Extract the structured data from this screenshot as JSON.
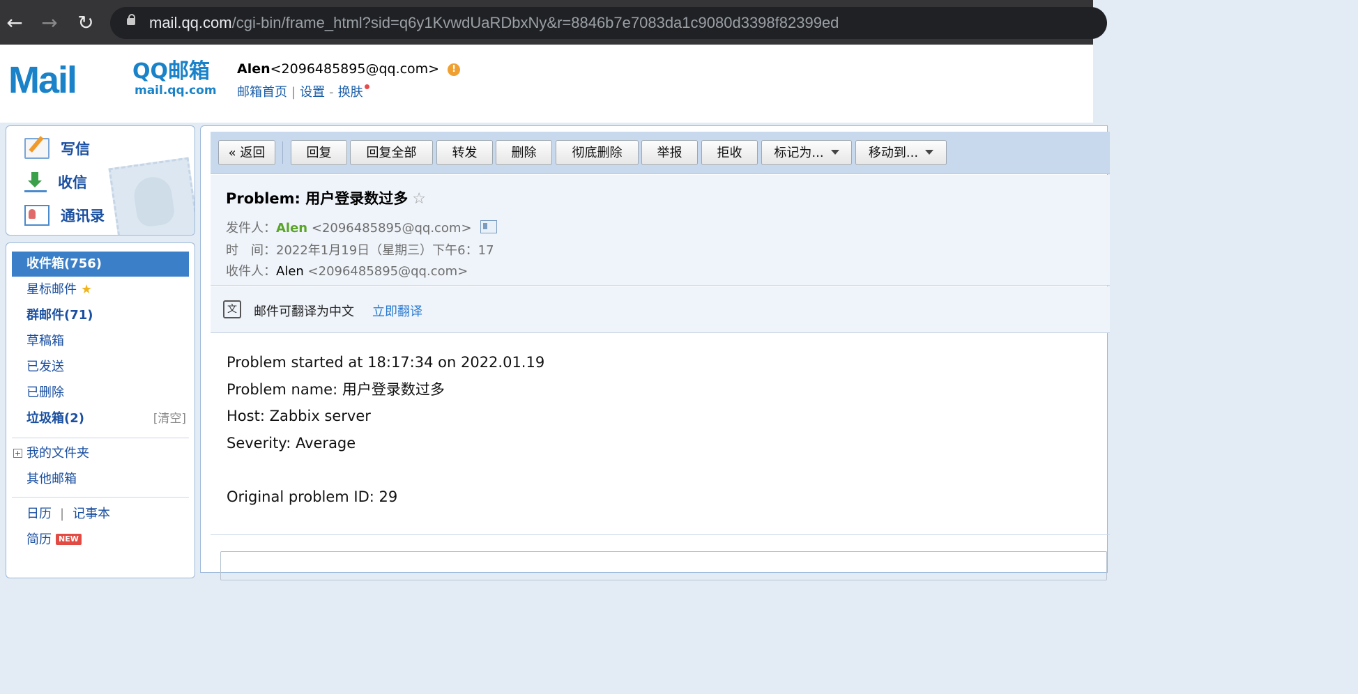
{
  "browser": {
    "url_host": "mail.qq.com",
    "url_path": "/cgi-bin/frame_html?sid=q6y1KvwdUaRDbxNy&r=8846b7e7083da1c9080d3398f82399ed"
  },
  "header": {
    "logo_mail": "Mail",
    "logo_qq": "QQ邮箱",
    "logo_domain": "mail.qq.com",
    "user_name": "Alen",
    "user_email": "<2096485895@qq.com>",
    "links": [
      "邮箱首页",
      "设置",
      "换肤"
    ]
  },
  "compose": {
    "write": "写信",
    "receive": "收信",
    "contacts": "通讯录"
  },
  "folders": {
    "inbox": "收件箱(756)",
    "starred": "星标邮件",
    "group": "群邮件(71)",
    "drafts": "草稿箱",
    "sent": "已发送",
    "deleted": "已删除",
    "spam": "垃圾箱(2)",
    "spam_clear": "[清空]",
    "my_folders": "我的文件夹",
    "other_mailboxes": "其他邮箱",
    "calendar": "日历",
    "notes": "记事本",
    "resume": "简历",
    "new_badge": "NEW"
  },
  "toolbar": {
    "back": "« 返回",
    "reply": "回复",
    "reply_all": "回复全部",
    "forward": "转发",
    "delete": "删除",
    "delete_permanent": "彻底删除",
    "report": "举报",
    "reject": "拒收",
    "mark_as": "标记为...",
    "move_to": "移动到..."
  },
  "mail": {
    "subject": "Problem: 用户登录数过多",
    "from_label": "发件人：",
    "from_name": "Alen",
    "from_email": "<2096485895@qq.com>",
    "time_label": "时　间：",
    "time_value": "2022年1月19日（星期三）下午6：17",
    "to_label": "收件人：",
    "to_name": "Alen",
    "to_email": "<2096485895@qq.com>",
    "translate_text": "邮件可翻译为中文",
    "translate_link": "立即翻译",
    "body_lines": [
      "Problem started at 18:17:34 on 2022.01.19",
      "Problem name: 用户登录数过多",
      "Host: Zabbix server",
      "Severity: Average",
      "",
      "Original problem ID: 29"
    ]
  },
  "colors": {
    "link_blue": "#1a4fa0",
    "active_folder": "#3a7fc7",
    "sender_green": "#5aa428",
    "toolbar_bg": "#c8d9ee"
  }
}
